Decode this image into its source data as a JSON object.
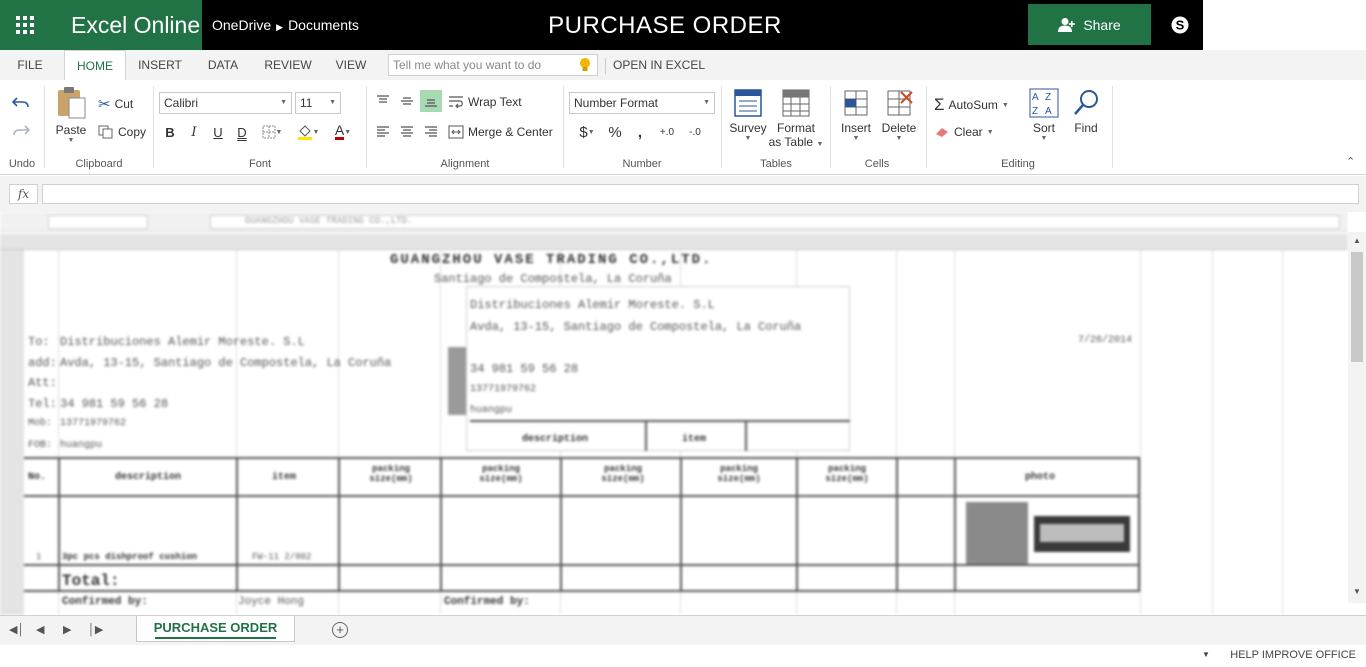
{
  "app": {
    "name": "Excel Online",
    "breadcrumb": [
      "OneDrive",
      "Documents"
    ],
    "title": "PURCHASE  ORDER",
    "share_label": "Share"
  },
  "tabs": [
    "FILE",
    "HOME",
    "INSERT",
    "DATA",
    "REVIEW",
    "VIEW"
  ],
  "active_tab": "HOME",
  "tell_me_placeholder": "Tell me what you want to do",
  "open_in_excel": "OPEN IN EXCEL",
  "ribbon": {
    "undo": {
      "label": "Undo"
    },
    "clipboard": {
      "label": "Clipboard",
      "paste": "Paste",
      "cut": "Cut",
      "copy": "Copy"
    },
    "font": {
      "label": "Font",
      "family": "Calibri",
      "size": "11",
      "bold": "B",
      "italic": "I",
      "underline": "U",
      "double_underline": "D",
      "font_color": "A"
    },
    "alignment": {
      "label": "Alignment",
      "wrap_text": "Wrap Text",
      "merge_center": "Merge & Center"
    },
    "number": {
      "label": "Number",
      "format": "Number Format",
      "currency": "$",
      "percent": "%",
      "comma": ",",
      "inc_decimal": "+.0",
      "dec_decimal": "-.0"
    },
    "tables": {
      "label": "Tables",
      "survey": "Survey",
      "format_as_table_1": "Format",
      "format_as_table_2": "as Table"
    },
    "cells": {
      "label": "Cells",
      "insert": "Insert",
      "delete": "Delete"
    },
    "editing": {
      "label": "Editing",
      "autosum": "AutoSum",
      "clear": "Clear",
      "sort": "Sort",
      "find": "Find"
    }
  },
  "formula_bar": {
    "fx": "fx",
    "value": ""
  },
  "sheet": {
    "blurred_header": "GUANGZHOU VASE TRADING CO.,LTD.",
    "blurred_subheader": "Santiago de Compostela, La Coruña",
    "to_line": "Distribuciones Alemir Moreste. S.L",
    "address_line": "Avda, 13-15, Santiago de Compostela, La Coruña",
    "tel_line": "34 981 59 56 28",
    "mob_line": "13771979762",
    "fob_line": "huangpu",
    "row_labels": [
      "To:",
      "add:",
      "Att:",
      "Tel:",
      "Mob:",
      "FOB:"
    ],
    "date": "7/26/2014",
    "table_headers": [
      "No.",
      "description",
      "item",
      "packing size(mm)",
      "packing size(mm)",
      "packing size(mm)",
      "packing size(mm)",
      "packing size(mm)",
      "photo"
    ],
    "row_item_no": "1",
    "row_description": "3pc pcs dishproof cushion",
    "row_item": "FW-11 2/802",
    "total_label": "Total:",
    "confirmed_by_1": "Confirmed by:",
    "confirmed_name": "Joyce Hong",
    "confirmed_by_2": "Confirmed by:"
  },
  "sheet_tab": "PURCHASE ORDER",
  "status": {
    "help": "HELP IMPROVE OFFICE"
  },
  "colors": {
    "brand_green": "#217346",
    "topbar_black": "#000000"
  }
}
